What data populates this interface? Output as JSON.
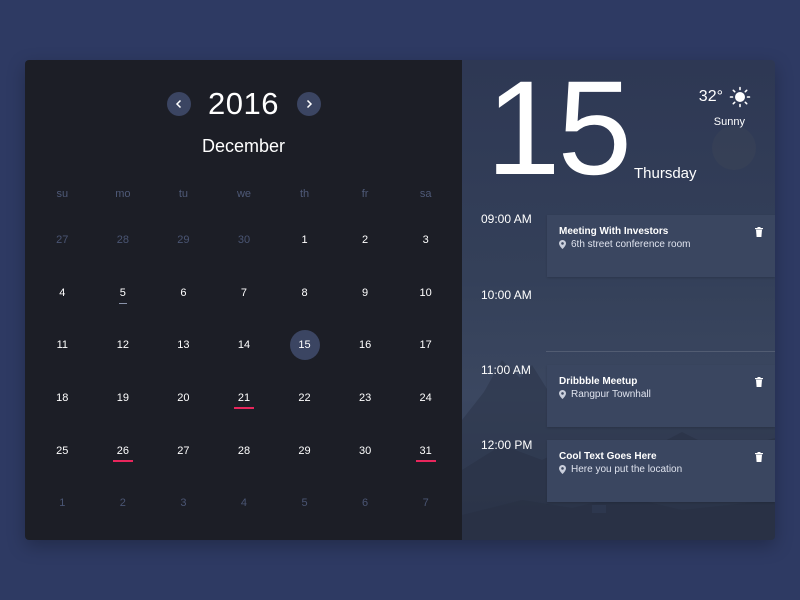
{
  "calendar": {
    "year": "2016",
    "month": "December",
    "weekdays": [
      "su",
      "mo",
      "tu",
      "we",
      "th",
      "fr",
      "sa"
    ],
    "weeks": [
      [
        {
          "d": "27",
          "muted": true
        },
        {
          "d": "28",
          "muted": true
        },
        {
          "d": "29",
          "muted": true
        },
        {
          "d": "30",
          "muted": true
        },
        {
          "d": "1"
        },
        {
          "d": "2"
        },
        {
          "d": "3"
        }
      ],
      [
        {
          "d": "4"
        },
        {
          "d": "5",
          "mark": "neutral"
        },
        {
          "d": "6"
        },
        {
          "d": "7"
        },
        {
          "d": "8"
        },
        {
          "d": "9"
        },
        {
          "d": "10"
        }
      ],
      [
        {
          "d": "11"
        },
        {
          "d": "12"
        },
        {
          "d": "13"
        },
        {
          "d": "14"
        },
        {
          "d": "15",
          "selected": true
        },
        {
          "d": "16"
        },
        {
          "d": "17"
        }
      ],
      [
        {
          "d": "18"
        },
        {
          "d": "19"
        },
        {
          "d": "20"
        },
        {
          "d": "21",
          "mark": "event"
        },
        {
          "d": "22"
        },
        {
          "d": "23"
        },
        {
          "d": "24"
        }
      ],
      [
        {
          "d": "25"
        },
        {
          "d": "26",
          "mark": "event"
        },
        {
          "d": "27"
        },
        {
          "d": "28"
        },
        {
          "d": "29"
        },
        {
          "d": "30"
        },
        {
          "d": "31",
          "mark": "event"
        }
      ],
      [
        {
          "d": "1",
          "muted": true
        },
        {
          "d": "2",
          "muted": true
        },
        {
          "d": "3",
          "muted": true
        },
        {
          "d": "4",
          "muted": true
        },
        {
          "d": "5",
          "muted": true
        },
        {
          "d": "6",
          "muted": true
        },
        {
          "d": "7",
          "muted": true
        }
      ]
    ],
    "prev_icon": "chevron-left-icon",
    "next_icon": "chevron-right-icon"
  },
  "day_view": {
    "day_number": "15",
    "weekday": "Thursday",
    "weather": {
      "temperature": "32°",
      "condition": "Sunny",
      "icon": "sun-icon"
    },
    "time_slots": [
      "09:00 AM",
      "10:00 AM",
      "11:00 AM",
      "12:00 PM"
    ],
    "events": [
      {
        "title": "Meeting With Investors",
        "location": "6th street conference room"
      },
      {
        "title": "Dribbble Meetup",
        "location": "Rangpur Townhall"
      },
      {
        "title": "Cool Text Goes Here",
        "location": "Here you put the location"
      }
    ]
  },
  "colors": {
    "page_bg": "#2e3a63",
    "calendar_bg": "#1c1e26",
    "selected_day": "#3b4562",
    "event_underline": "#e8265c",
    "event_card": "#3a4660"
  }
}
